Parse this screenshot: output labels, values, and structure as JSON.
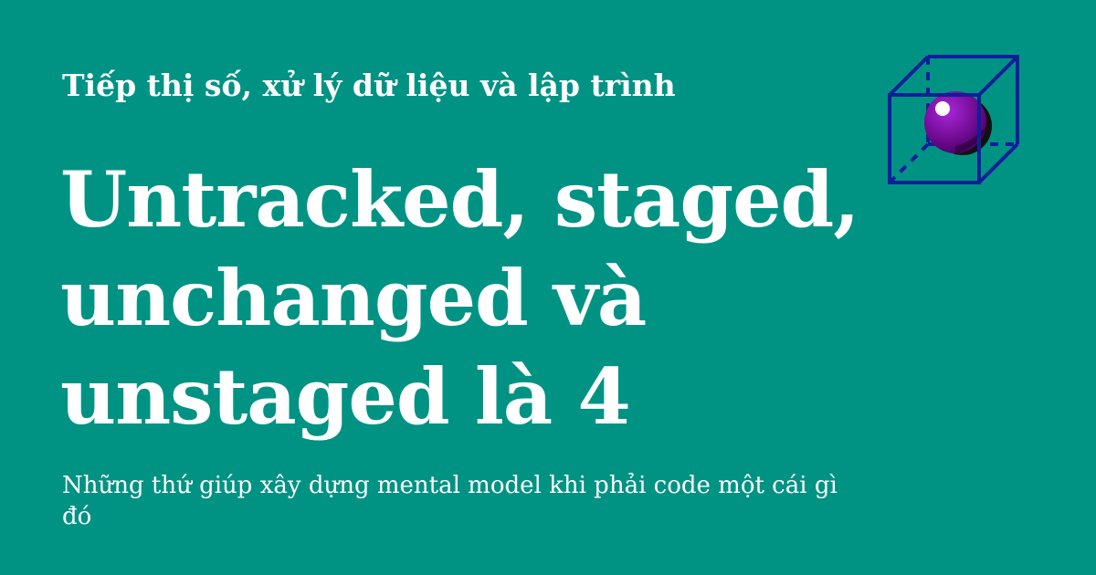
{
  "header": {
    "site_name": "Tiếp thị số, xử lý dữ liệu và lập trình"
  },
  "article": {
    "title_lines": [
      "Untracked, staged,",
      "unchanged và",
      "unstaged là 4"
    ],
    "subtitle": "Những thứ giúp xây dựng mental model khi phải code một cái gì đó"
  },
  "logo": {
    "icon": "cube-sphere-icon"
  },
  "colors": {
    "background": "#009384",
    "text": "#ffffff",
    "cube_stroke": "#0f1f9a",
    "sphere": "#7a0f9e",
    "sphere_shadow": "#111111"
  }
}
